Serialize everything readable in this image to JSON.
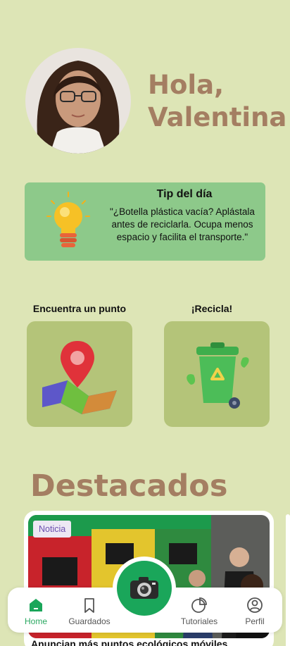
{
  "greeting": {
    "line1": "Hola,",
    "line2": "Valentina"
  },
  "tip": {
    "title": "Tip del día",
    "body": "\"¿Botella plástica vacía? Aplástala antes de reciclarla. Ocupa menos espacio y facilita el transporte.\"",
    "icon": "lightbulb-icon"
  },
  "actions": {
    "find_point": {
      "label": "Encuentra un punto",
      "icon": "map-pin-icon"
    },
    "recycle": {
      "label": "¡Recicla!",
      "icon": "recycle-bin-icon"
    }
  },
  "featured": {
    "title": "Destacados",
    "card": {
      "badge": "Noticia",
      "headline": "Anuncian más puntos ecológicos móviles"
    }
  },
  "nav": {
    "home": "Home",
    "saved": "Guardados",
    "tutorials": "Tutoriales",
    "profile": "Perfil",
    "camera_icon": "camera-icon"
  },
  "colors": {
    "background": "#dde5b6",
    "accent_brown": "#a47e62",
    "tip_green": "#8dc98a",
    "card_green": "#b4c479",
    "active_green": "#2aa861"
  }
}
